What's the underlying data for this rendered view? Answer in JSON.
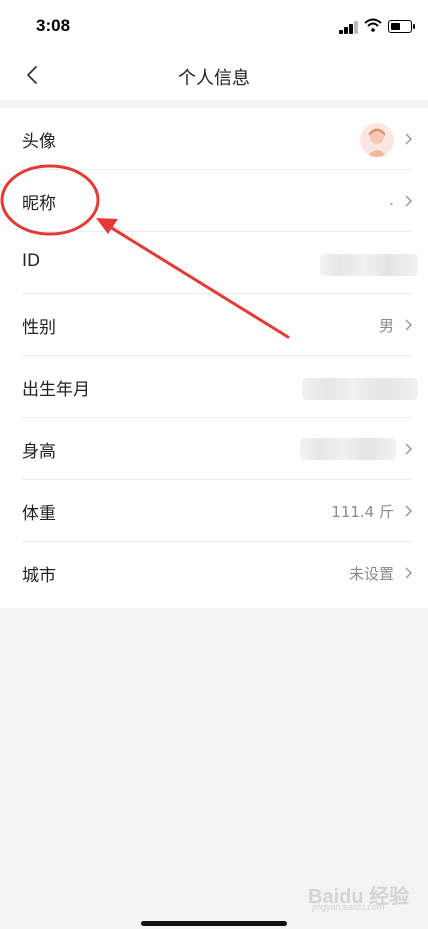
{
  "status_bar": {
    "time": "3:08"
  },
  "nav": {
    "title": "个人信息",
    "back_icon": "chevron-left-icon"
  },
  "rows": [
    {
      "label": "头像",
      "value": ""
    },
    {
      "label": "昵称",
      "value": "."
    },
    {
      "label": "ID",
      "value": ""
    },
    {
      "label": "性别",
      "value": "男"
    },
    {
      "label": "出生年月",
      "value": ""
    },
    {
      "label": "身高",
      "value": ""
    },
    {
      "label": "体重",
      "value": "111.4 斤"
    },
    {
      "label": "城市",
      "value": "未设置"
    }
  ],
  "watermark": {
    "brand": "Baidu 经验",
    "url": "jingyan.baidu.com"
  },
  "colors": {
    "annotation": "#e53935",
    "label": "#222222",
    "value": "#8a8a8a",
    "background": "#f4f4f4"
  }
}
